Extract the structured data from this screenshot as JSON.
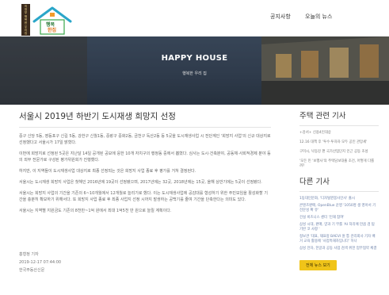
{
  "header": {
    "logo_text": [
      "의",
      "정",
      "부",
      "행",
      "복",
      "한",
      "우",
      "리",
      "집"
    ],
    "logo_alt": "행복한 우리 집",
    "nav": [
      "공지사항",
      "오늘의 뉴스"
    ]
  },
  "hero": {
    "title": "HAPPY HOUSE",
    "subtitle": "행복한 우리 집"
  },
  "article": {
    "title": "서울시 2019년 하반기 도시재생 희망지 선정",
    "paragraphs": [
      "중구 신당 5동, 영등포구 신길 5동, 강한구 신월1동, 중랑구 중화2동, 금천구 독산2동 등 5곳을 도시재생사업 시 전단계인 '희망지 사업'의 신규 대상지로 선정했다고 서울시가 17일 밝혔다.",
      "이번에 희망지로 선정된 5곳은 지난달 14일 공개된 공모에 응한 10개 자치구의 행정동 중에서 뽑혔다. 심사는 도시·건축분야, 공동체·사회적경제 분야 등의 외부 전문가로 구성된 평가위원회가 진행했다.",
      "하지만, 이 지역들이 도시재생사업 대상지로 최종 선정되는 것은 희망지 사업 종료 후 평가를 거쳐 결정된다.",
      "서울시는 도시재생 희망지 사업은 첫해인 2016년에 19곳이 선정됐으며, 2017년에는 32곳, 2018년에는 15곳, 올해 상반기에는 5곳이 선정됐다.",
      "서울시는 희망지 사업의 기간을 기존의 6~10개월에서 12개월로 늘리기로 했다. 이는 도시재생사업에 공감대를 형성하기 위한 주민모임을 활성화할 기간을 충분히 확보하기 위해서다. 또 희망지 사업 종료 후 최종 사업지 선정 시까지 발생하는 공백기를 줄여 기간을 단축한다는 의미도 있다.",
      "서울시는 지역별 지원금도 기존의 8천만~1억 원에서 최대 1억5천 만 원으로 늘릴 계획이다."
    ],
    "byline": [
      "홍형정 기자",
      "2019-12-17 07:44:00",
      "한국주동산신문"
    ]
  },
  "sidebar": {
    "related_title": "주택 관련 기사",
    "related": [
      "+강서+ 신용4인대상",
      "12.16 대책 후 '투수·투자자 모두 공인 관망세'",
      "구미시, 낙동강 편 국가산업단지 인근 공동 조성",
      "'모든 민 '보행사'의 주택담보대출 조건, 어떻게 다를까?"
    ],
    "other_title": "다른 기사",
    "other": [
      "1동대인문화, '디자털뮌봉사인사' 출시",
      "콘텐츠판매, OpenBlue 운영 '1050명 생 영아서 기 전문성 확 유' ",
      "건설 비즈니스 센터 '인재 참여'",
      "삼성 시대, 판매, 양과 기 무를 'AI 처리에 만큼 검 탐 기반 코 사항 '",
      "정보관 '대표, 재표정 BAEVI 원 통 관리회사 기자 배 거 교육 활용에 '사업특재자입니다' 하나",
      "삼성 전자, 한글과 공동 사업 검색 위한 업무협약 체결"
    ],
    "more_label": "전체 뉴스 보기"
  },
  "colors": {
    "accent": "#f0c419",
    "link": "#6a7fa8"
  }
}
